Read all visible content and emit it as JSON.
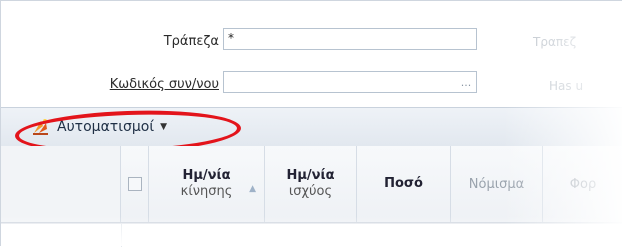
{
  "form": {
    "bank_label": "Τράπεζα",
    "bank_value": "*",
    "bank_ghost_label": "Τραπεζ",
    "account_label": "Κωδικός συν/νου",
    "account_value": "",
    "account_lookup": "...",
    "ghost_label_2": "Has u"
  },
  "toolbar": {
    "automation_label": "Αυτοματισμοί",
    "automation_caret": "▼"
  },
  "grid": {
    "columns": [
      {
        "title": "Ημ/νία",
        "subtitle": "κίνησης"
      },
      {
        "title": "Ημ/νία",
        "subtitle": "ισχύος"
      },
      {
        "title": "Ποσό",
        "subtitle": ""
      },
      {
        "title": "Νόμισμα",
        "subtitle": ""
      },
      {
        "title": "Φορ",
        "subtitle": ""
      }
    ]
  },
  "colors": {
    "highlight": "#e3141b",
    "toolbar_text": "#1f2f45"
  }
}
